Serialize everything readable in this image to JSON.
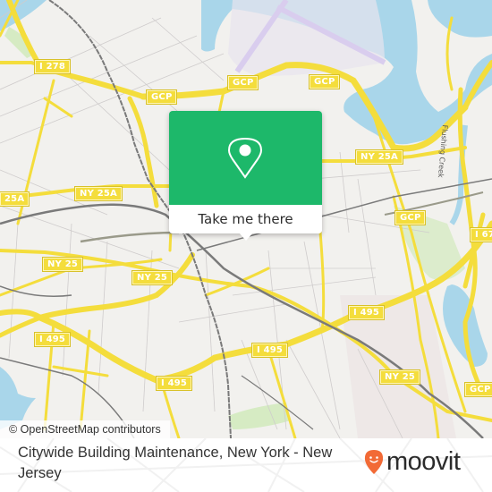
{
  "map": {
    "attribution": "© OpenStreetMap contributors",
    "colors": {
      "land": "#f2f1ee",
      "water": "#a9d6ea",
      "highway": "#f4dd3c",
      "park": "#d6ebc3",
      "airport": "#e6dff2",
      "rail": "#777777"
    },
    "road_labels": [
      {
        "id": "i278",
        "text": "I 278"
      },
      {
        "id": "gcp1",
        "text": "GCP"
      },
      {
        "id": "gcp2",
        "text": "GCP"
      },
      {
        "id": "gcp3",
        "text": "GCP"
      },
      {
        "id": "ny25a-left",
        "text": "25A"
      },
      {
        "id": "ny25a-mid",
        "text": "NY 25A"
      },
      {
        "id": "ny25a-right",
        "text": "NY 25A"
      },
      {
        "id": "gcp4",
        "text": "GCP"
      },
      {
        "id": "i678",
        "text": "I 67"
      },
      {
        "id": "ny25-left",
        "text": "NY 25"
      },
      {
        "id": "ny25-mid",
        "text": "NY 25"
      },
      {
        "id": "i495-mid",
        "text": "I 495"
      },
      {
        "id": "i495-left",
        "text": "I 495"
      },
      {
        "id": "i495-bottom",
        "text": "I 495"
      },
      {
        "id": "i495-center",
        "text": "I 495"
      },
      {
        "id": "ny25-right",
        "text": "NY 25"
      },
      {
        "id": "gcp5",
        "text": "GCP"
      }
    ],
    "water_label": "Flushing Creek"
  },
  "popup": {
    "button_label": "Take me there",
    "icon": "map-pin-icon",
    "color": "#1db86a"
  },
  "footer": {
    "title": "Citywide Building Maintenance, New York - New Jersey",
    "logo_text": "moovit",
    "logo_color": "#f26a36"
  }
}
